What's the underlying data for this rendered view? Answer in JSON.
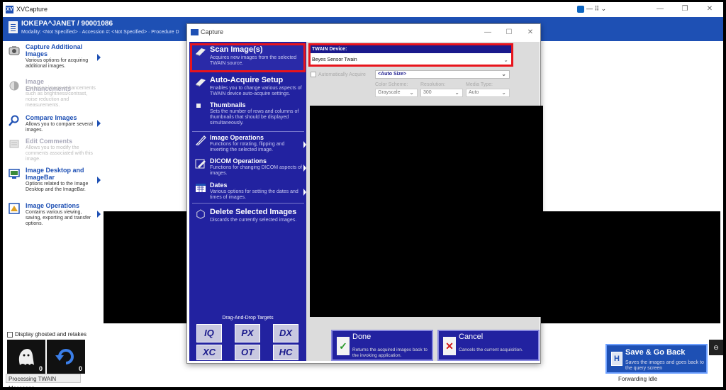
{
  "window": {
    "title": "XVCapture",
    "app_icon": "XV"
  },
  "header": {
    "patient": "IOKEPA^JANET / 90001086",
    "sub": "Modality: <Not Specified> · Accession #: <Not Specified> · Procedure D"
  },
  "sidebar": {
    "items": [
      {
        "title": "Capture Additional Images",
        "desc": "Various options for acquiring additional images.",
        "icon": "camera-icon",
        "enabled": true
      },
      {
        "title": "Image Enhancements",
        "desc": "Accesses image enhancements such as brightness/contrast, noise reduction and measurements.",
        "icon": "enhance-icon",
        "enabled": false
      },
      {
        "title": "Compare Images",
        "desc": "Allows you to compare several images.",
        "icon": "magnifier-icon",
        "enabled": true
      },
      {
        "title": "Edit Comments",
        "desc": "Allows you to modify the comments associated with this image.",
        "icon": "comment-icon",
        "enabled": false
      },
      {
        "title": "Image Desktop and ImageBar",
        "desc": "Options related to the Image Desktop and the ImageBar.",
        "icon": "desktop-icon",
        "enabled": true
      },
      {
        "title": "Image Operations",
        "desc": "Contains various viewing, saving, exporting and transfer options.",
        "icon": "operations-icon",
        "enabled": true
      }
    ]
  },
  "bottom": {
    "ghost_label": "Display ghosted and retakes",
    "thumb_counts": [
      "0",
      "0"
    ],
    "status": "Processing TWAIN Messages",
    "forwarding": "Forwarding Idle",
    "save_go": {
      "title": "Save & Go Back",
      "desc": "Saves the images and goes back to the query screen"
    }
  },
  "dialog": {
    "title": "Capture",
    "menu": [
      {
        "title": "Scan Image(s)",
        "desc": "Acquires new images from the selected TWAIN source."
      },
      {
        "title": "Auto-Acquire Setup",
        "desc": "Enables you to change various aspects of TWAIN device auto-acquire settings."
      },
      {
        "title": "Thumbnails",
        "desc": "Sets the number of rows and columns of thumbnails that should be displayed simultaneously."
      },
      {
        "title": "Image Operations",
        "desc": "Functions for rotating, flipping and inverting the selected image."
      },
      {
        "title": "DICOM Operations",
        "desc": "Functions for changing DICOM aspects of images."
      },
      {
        "title": "Dates",
        "desc": "Various options for setting the dates and times of images."
      },
      {
        "title": "Delete Selected Images",
        "desc": "Discards the currently selected images."
      }
    ],
    "dnd_label": "Drag-And-Drop Targets",
    "dnd_targets": [
      "IQ",
      "PX",
      "DX",
      "XC",
      "OT",
      "HC"
    ],
    "twain_label": "TWAIN Device:",
    "twain_device": "Beyes Sensor Twain",
    "auto_acquire_label": "Automatically Acquire",
    "auto_size": "<Auto Size>",
    "color_scheme_label": "Color Scheme:",
    "color_scheme": "Grayscale",
    "resolution_label": "Resolution:",
    "resolution": "300",
    "media_type_label": "Media Type:",
    "media_type": "Auto",
    "done": {
      "title": "Done",
      "desc": "Returns the acquired images back to the invoking application."
    },
    "cancel": {
      "title": "Cancel",
      "desc": "Cancels the current acquisition."
    }
  },
  "colors": {
    "brand_blue": "#1e50b4",
    "menu_blue": "#2222a0",
    "highlight_red": "#e8141c"
  }
}
